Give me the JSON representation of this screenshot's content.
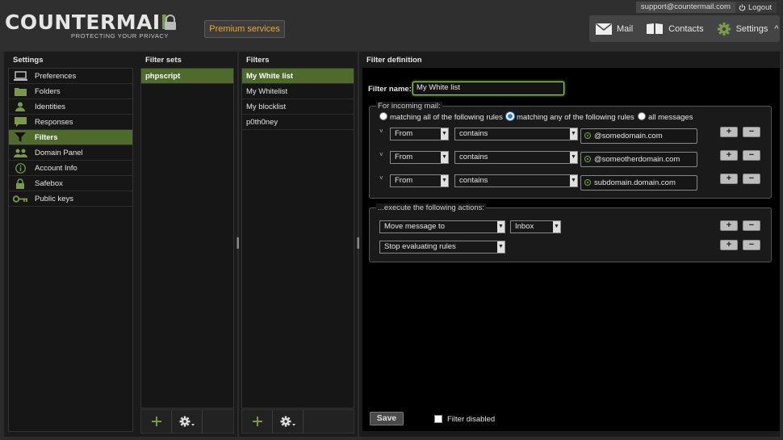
{
  "header": {
    "logo_bright": "COUNTERMAI",
    "logo_accent": "L",
    "tagline": "PROTECTING YOUR PRIVACY",
    "premium_label": "Premium services",
    "account_email": "support@countermail.com",
    "logout_label": "Logout",
    "nav": {
      "mail": "Mail",
      "contacts": "Contacts",
      "settings": "Settings"
    }
  },
  "settings": {
    "title": "Settings",
    "items": [
      {
        "label": "Preferences",
        "icon": "laptop-icon"
      },
      {
        "label": "Folders",
        "icon": "folder-icon"
      },
      {
        "label": "Identities",
        "icon": "user-icon"
      },
      {
        "label": "Responses",
        "icon": "speech-bubble-icon"
      },
      {
        "label": "Filters",
        "icon": "filter-icon"
      },
      {
        "label": "Domain Panel",
        "icon": "group-icon"
      },
      {
        "label": "Account Info",
        "icon": "info-icon"
      },
      {
        "label": "Safebox",
        "icon": "lock-icon"
      },
      {
        "label": "Public keys",
        "icon": "key-icon"
      }
    ],
    "active_index": 4
  },
  "filter_sets": {
    "title": "Filter sets",
    "items": [
      "phpscript"
    ],
    "active_index": 0
  },
  "filters": {
    "title": "Filters",
    "items": [
      "My White list",
      "My Whitelist",
      "My blocklist",
      "p0th0ney"
    ],
    "active_index": 0
  },
  "definition": {
    "title": "Filter definition",
    "name_label": "Filter name:",
    "name_value": "My White list",
    "incoming_legend": "For incoming mail:",
    "match_options": [
      "matching all of the following rules",
      "matching any of the following rules",
      "all messages"
    ],
    "match_selected": 1,
    "rules": [
      {
        "field": "From",
        "op": "contains",
        "value": "@somedomain.com"
      },
      {
        "field": "From",
        "op": "contains",
        "value": "@someotherdomain.com"
      },
      {
        "field": "From",
        "op": "contains",
        "value": "subdomain.domain.com"
      }
    ],
    "actions_legend": "...execute the following actions:",
    "actions": [
      {
        "action": "Move message to",
        "target": "Inbox"
      },
      {
        "action": "Stop evaluating rules",
        "target": ""
      }
    ],
    "save_label": "Save",
    "disabled_label": "Filter disabled"
  },
  "colors": {
    "accent": "#4e6b2c",
    "premium": "#f0a526",
    "logo_green": "#7a9a4a"
  }
}
